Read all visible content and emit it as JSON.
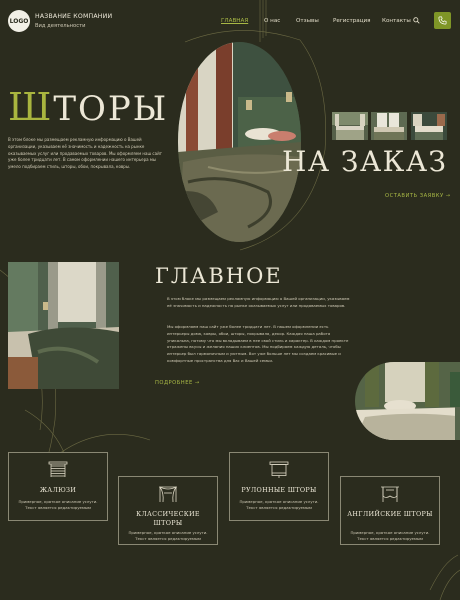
{
  "header": {
    "logo": "LOGO",
    "company_name": "НАЗВАНИЕ КОМПАНИИ",
    "company_sub": "Вид деятельности",
    "nav": [
      "ГЛАВНАЯ",
      "О нас",
      "Отзывы",
      "Регистрация",
      "Контакты"
    ],
    "search_icon": "search-icon",
    "phone_icon": "phone-icon"
  },
  "hero": {
    "title_first": "Ш",
    "title_rest": "ТОРЫ",
    "title_line2": "НА ЗАКАЗ",
    "text": "В этом блоке мы размещаем рекламную информацию о Вашей организации, указываем её значимость и надежность на рынке оказываемых услуг или продаваемых товаров. Мы оформляем наш сайт уже более тридцати лет. В самом оформлении нашего интерьера мы умело подбираем стиль, шторы, обои, покрывала, ковры.",
    "leave_request": "ОСТАВИТЬ ЗАЯВКУ →"
  },
  "main": {
    "title": "ГЛАВНОЕ",
    "p1": "В этом блоке мы размещаем рекламную информацию о Вашей организации, указываем её значимость и надежность на рынке оказываемых услуг или продаваемых товаров.",
    "p2": "Мы оформляем наш сайт уже более тридцати лет. В нашем оформлении есть интерьеры дома, ковры, обои, шторы, покрывала, декор. Каждая наша работа уникальна, потому что мы вкладываем в нее свой стиль и характер. В каждом проекте отражены вкусы и желания наших клиентов. Мы подбираем каждую деталь, чтобы интерьер был гармоничным и уютным. Вот уже больше лет мы создаем красивые и комфортные пространства для Вас и Вашей семьи.",
    "more": "ПОДРОБНЕЕ →"
  },
  "cards": [
    {
      "title": "ЖАЛЮЗИ",
      "desc": "Примерное, краткое описание услуги. Текст является редактируемым",
      "icon": "blinds-icon"
    },
    {
      "title": "КЛАССИЧЕСКИЕ ШТОРЫ",
      "desc": "Примерное, краткое описание услуги. Текст является редактируемым",
      "icon": "classic-curtains-icon"
    },
    {
      "title": "РУЛОННЫЕ ШТОРЫ",
      "desc": "Примерное, краткое описание услуги. Текст является редактируемым",
      "icon": "roller-blinds-icon"
    },
    {
      "title": "АНГЛИЙСКИЕ ШТОРЫ",
      "desc": "Примерное, краткое описание услуги. Текст является редактируемым",
      "icon": "english-curtains-icon"
    }
  ],
  "colors": {
    "background": "#2b2c1e",
    "accent": "#a8b845",
    "button": "#7f9627",
    "text": "#ece7d6"
  }
}
